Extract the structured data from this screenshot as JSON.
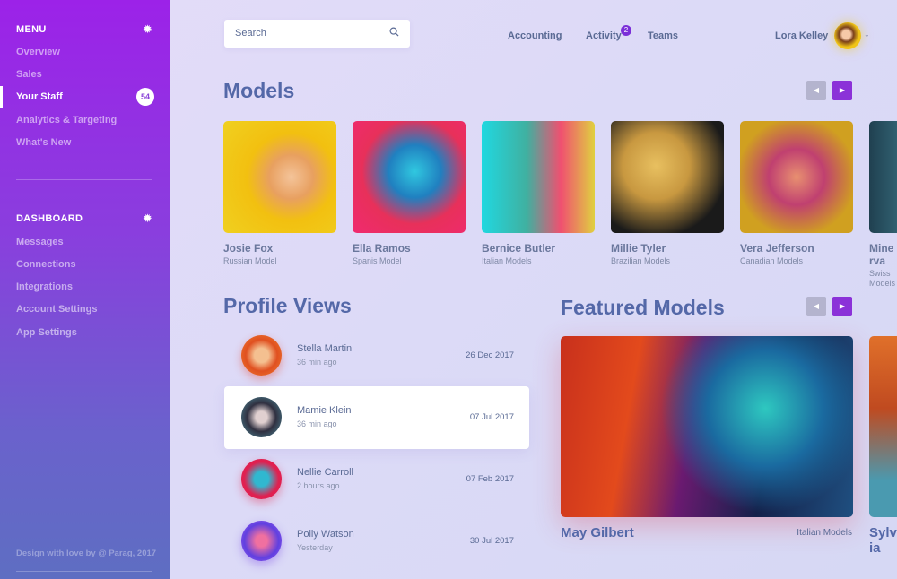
{
  "sidebar": {
    "menu_title": "MENU",
    "menu_items": [
      {
        "label": "Overview"
      },
      {
        "label": "Sales"
      },
      {
        "label": "Your Staff",
        "badge": "54",
        "active": true
      },
      {
        "label": "Analytics & Targeting"
      },
      {
        "label": "What's New"
      }
    ],
    "dashboard_title": "DASHBOARD",
    "dashboard_items": [
      {
        "label": "Messages"
      },
      {
        "label": "Connections"
      },
      {
        "label": "Integrations"
      },
      {
        "label": "Account Settings"
      },
      {
        "label": "App Settings"
      }
    ],
    "footer": "Design with love by @ Parag, 2017"
  },
  "header": {
    "search_placeholder": "Search",
    "nav": [
      {
        "label": "Accounting"
      },
      {
        "label": "Activity",
        "badge": "2"
      },
      {
        "label": "Teams"
      }
    ],
    "user_name": "Lora Kelley"
  },
  "models": {
    "title": "Models",
    "items": [
      {
        "name": "Josie Fox",
        "subtitle": "Russian Model"
      },
      {
        "name": "Ella Ramos",
        "subtitle": "Spanis Model"
      },
      {
        "name": "Bernice Butler",
        "subtitle": "Italian Models"
      },
      {
        "name": "Millie Tyler",
        "subtitle": "Brazilian Models"
      },
      {
        "name": "Vera Jefferson",
        "subtitle": "Canadian Models"
      },
      {
        "name": "Minerva",
        "subtitle": "Swiss Models"
      }
    ]
  },
  "profile_views": {
    "title": "Profile Views",
    "rows": [
      {
        "name": "Stella Martin",
        "time": "36 min ago",
        "date": "26 Dec 2017"
      },
      {
        "name": "Mamie Klein",
        "time": "36 min ago",
        "date": "07 Jul 2017",
        "highlighted": true
      },
      {
        "name": "Nellie Carroll",
        "time": "2 hours ago",
        "date": "07 Feb 2017"
      },
      {
        "name": "Polly Watson",
        "time": "Yesterday",
        "date": "30 Jul 2017"
      }
    ]
  },
  "featured": {
    "title": "Featured Models",
    "items": [
      {
        "name": "May Gilbert",
        "subtitle": "Italian Models"
      },
      {
        "name": "Sylvia"
      }
    ]
  },
  "colors": {
    "accent": "#8b32d8",
    "heading": "#5468a8",
    "sidebar_top": "#9c22e8",
    "sidebar_bottom": "#5e6ec2"
  }
}
